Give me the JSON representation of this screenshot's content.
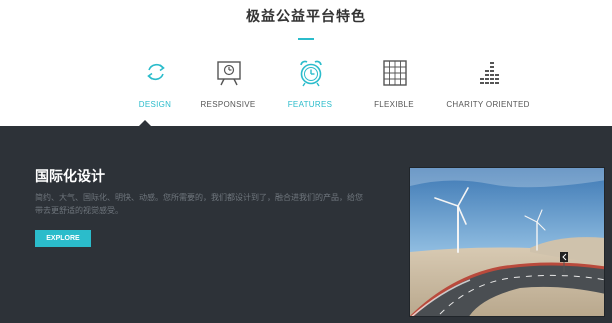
{
  "section_title": "极益公益平台特色",
  "tabs": [
    {
      "label": "DESIGN",
      "icon": "refresh-icon",
      "active": true
    },
    {
      "label": "RESPONSIVE",
      "icon": "presentation-board-icon",
      "active": false
    },
    {
      "label": "FEATURES",
      "icon": "alarm-clock-icon",
      "active": false
    },
    {
      "label": "FLEXIBLE",
      "icon": "grid-icon",
      "active": false
    },
    {
      "label": "CHARITY ORIENTED",
      "icon": "equalizer-icon",
      "active": false
    }
  ],
  "panel": {
    "heading": "国际化设计",
    "description": "简约、大气、国际化、明快、动感。您所需要的，我们都设计到了，融合进我们的产品，给您带去更舒适的视觉感受。",
    "button_label": "EXPLORE"
  },
  "colors": {
    "accent": "#2bbccb",
    "dark_bg": "#2d3238",
    "title": "#333333"
  }
}
